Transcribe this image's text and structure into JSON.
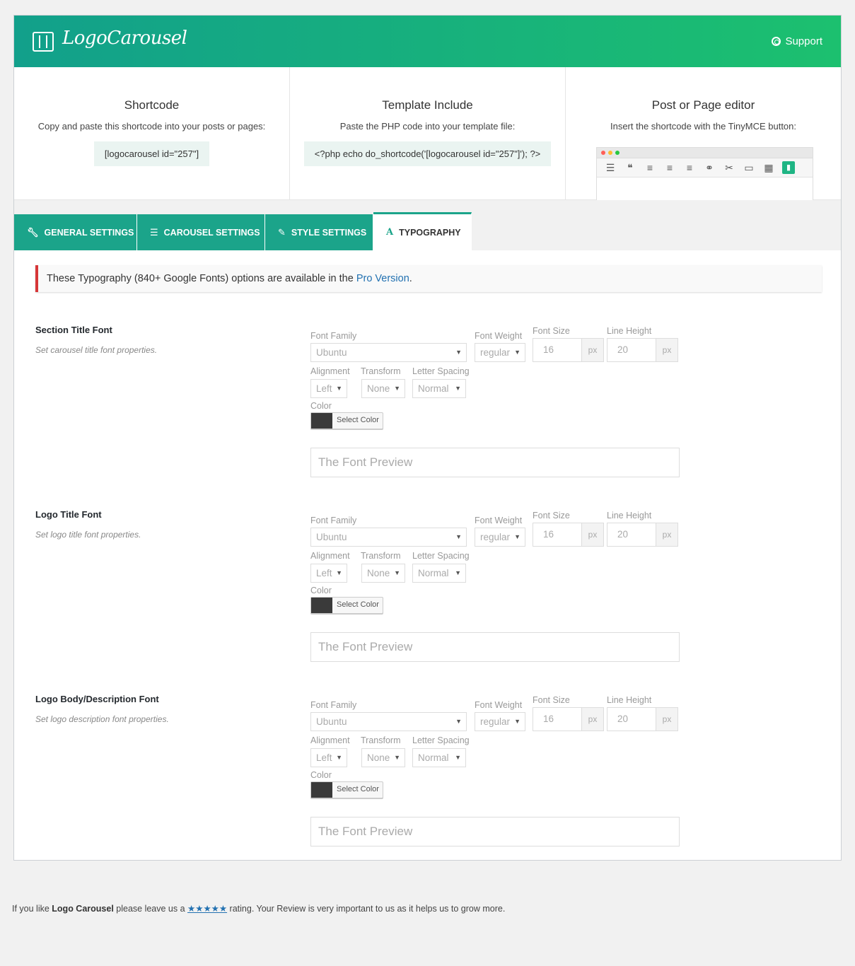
{
  "header": {
    "logo_text": "LogoCarousel",
    "support_label": "Support"
  },
  "info": [
    {
      "title": "Shortcode",
      "desc": "Copy and paste this shortcode into your posts or pages:",
      "code": "[logocarousel id=\"257\"]"
    },
    {
      "title": "Template Include",
      "desc": "Paste the PHP code into your template file:",
      "code": "<?php echo do_shortcode('[logocarousel id=\"257\"]'); ?>"
    },
    {
      "title": "Post or Page editor",
      "desc": "Insert the shortcode with the TinyMCE button:"
    }
  ],
  "editor_tools": [
    "list-numbered-icon",
    "blockquote-icon",
    "align-left-icon",
    "align-center-icon",
    "align-right-icon",
    "link-icon",
    "unlink-icon",
    "read-more-icon",
    "keyboard-icon",
    "logo-carousel-icon"
  ],
  "tabs": [
    {
      "label": "GENERAL SETTINGS",
      "icon": "wrench-icon",
      "active": false
    },
    {
      "label": "CAROUSEL SETTINGS",
      "icon": "sliders-icon",
      "active": false
    },
    {
      "label": "STYLE SETTINGS",
      "icon": "brush-icon",
      "active": false
    },
    {
      "label": "TYPOGRAPHY",
      "icon": "font-icon",
      "active": true
    }
  ],
  "notice": {
    "prefix": "These Typography (840+ Google Fonts) options are available in the ",
    "link": "Pro Version",
    "suffix": "."
  },
  "labels": {
    "font_family": "Font Family",
    "font_weight": "Font Weight",
    "font_size": "Font Size",
    "line_height": "Line Height",
    "alignment": "Alignment",
    "transform": "Transform",
    "letter_spacing": "Letter Spacing",
    "color": "Color",
    "select_color": "Select Color",
    "unit": "px",
    "preview": "The Font Preview"
  },
  "sections": [
    {
      "title": "Section Title Font",
      "desc": "Set carousel title font properties.",
      "font_family": "Ubuntu",
      "font_weight": "regular",
      "font_size": "16",
      "line_height": "20",
      "alignment": "Left",
      "transform": "None",
      "letter_spacing": "Normal",
      "color": "#3a3a3a"
    },
    {
      "title": "Logo Title Font",
      "desc": "Set logo title font properties.",
      "font_family": "Ubuntu",
      "font_weight": "regular",
      "font_size": "16",
      "line_height": "20",
      "alignment": "Left",
      "transform": "None",
      "letter_spacing": "Normal",
      "color": "#3a3a3a"
    },
    {
      "title": "Logo Body/Description Font",
      "desc": "Set logo description font properties.",
      "font_family": "Ubuntu",
      "font_weight": "regular",
      "font_size": "16",
      "line_height": "20",
      "alignment": "Left",
      "transform": "None",
      "letter_spacing": "Normal",
      "color": "#3a3a3a"
    }
  ],
  "footer": {
    "p1": "If you like ",
    "name": "Logo Carousel",
    "p2": " please leave us a ",
    "stars": "★★★★★",
    "p3": " rating. Your Review is very important to us as it helps us to grow more."
  }
}
